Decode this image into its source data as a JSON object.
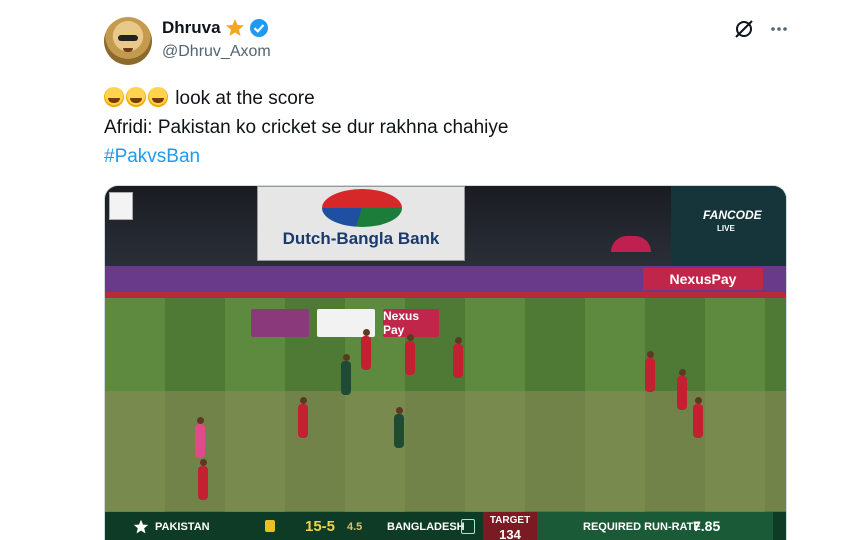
{
  "author": {
    "name": "Dhruva",
    "handle": "@Dhruv_Axom"
  },
  "icons": {
    "badge": "star-badge-icon",
    "verified": "verified-icon",
    "grok": "grok-icon",
    "more": "more-icon",
    "emoji": "rolling-laughing-emoji"
  },
  "tweet": {
    "line1": "look at the score",
    "line2": "Afridi: Pakistan ko cricket se dur rakhna chahiye",
    "hashtag": "#PakvsBan"
  },
  "media": {
    "billboard": "Dutch-Bangla Bank",
    "broadcaster": "FANCODE",
    "broadcaster_sub": "LIVE",
    "ad_nexus": "NexusPay",
    "sponsor_nexus": "Nexus Pay",
    "scorebar": {
      "team1": "PAKISTAN",
      "score": "15-5",
      "overs": "4.5",
      "team2": "BANGLADESH",
      "target_label": "TARGET",
      "target_value": "134",
      "rrr_label": "REQUIRED RUN-RATE",
      "rrr_value": "7.85"
    }
  },
  "colors": {
    "hashtag": "#1d9bf0",
    "verified": "#1d9bf0",
    "scorebar": "#0d3b25"
  }
}
